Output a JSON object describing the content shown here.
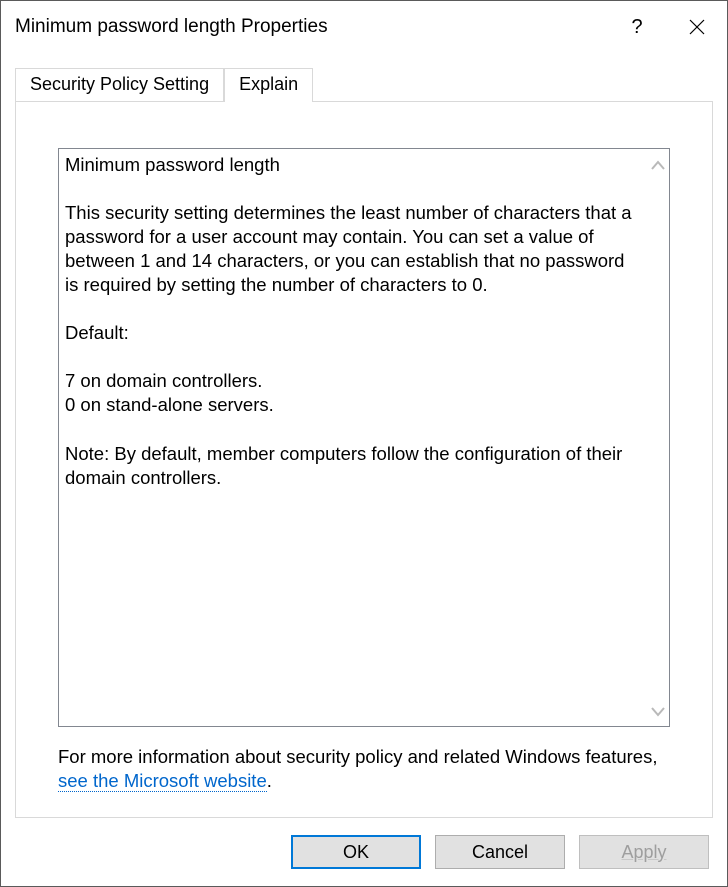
{
  "window": {
    "title": "Minimum password length Properties",
    "help_symbol": "?",
    "close_label": "Close"
  },
  "tabs": {
    "security_label": "Security Policy Setting",
    "explain_label": "Explain",
    "active": "explain"
  },
  "explain": {
    "text": "Minimum password length\n\nThis security setting determines the least number of characters that a password for a user account may contain. You can set a value of between 1 and 14 characters, or you can establish that no password is required by setting the number of characters to 0.\n\nDefault:\n\n7 on domain controllers.\n0 on stand-alone servers.\n\nNote: By default, member computers follow the configuration of their domain controllers.\n"
  },
  "footer": {
    "prefix": "For more information about security policy and related Windows features, ",
    "link_text": "see the Microsoft website",
    "suffix": "."
  },
  "buttons": {
    "ok": "OK",
    "cancel": "Cancel",
    "apply": "Apply"
  }
}
